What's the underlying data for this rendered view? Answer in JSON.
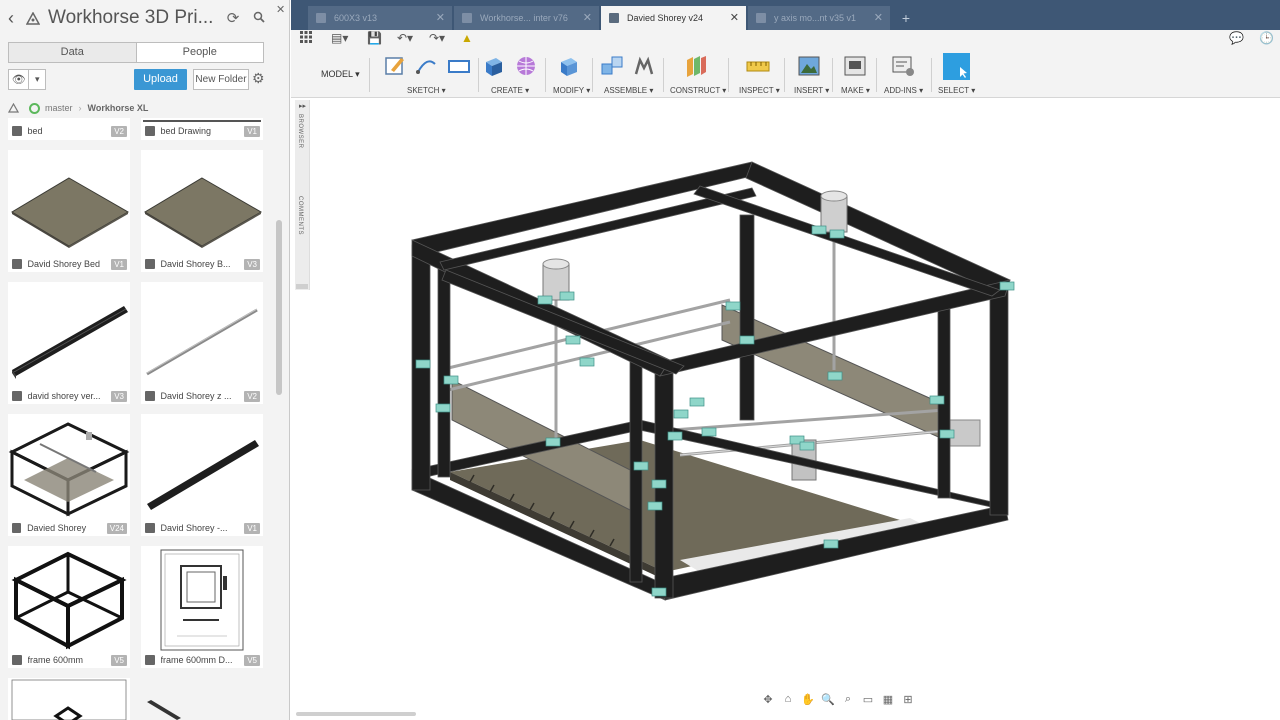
{
  "left_panel": {
    "title": "Workhorse 3D Pri...",
    "tabs": [
      "Data",
      "People"
    ],
    "upload_label": "Upload",
    "new_folder_label": "New Folder",
    "breadcrumb": [
      "master",
      "Workhorse XL"
    ],
    "files": [
      {
        "name": "bed",
        "version": "V2"
      },
      {
        "name": "bed Drawing",
        "version": "V1"
      },
      {
        "name": "David Shorey Bed",
        "version": "V1"
      },
      {
        "name": "David Shorey B...",
        "version": "V3"
      },
      {
        "name": "david shorey ver...",
        "version": "V3"
      },
      {
        "name": "David Shorey z ...",
        "version": "V2"
      },
      {
        "name": "Davied Shorey",
        "version": "V24"
      },
      {
        "name": "David Shorey -...",
        "version": "V1"
      },
      {
        "name": "frame 600mm",
        "version": "V5"
      },
      {
        "name": "frame 600mm D...",
        "version": "V5"
      }
    ]
  },
  "tabs": [
    {
      "label": "600X3 v13"
    },
    {
      "label": "Workhorse... inter v76"
    },
    {
      "label": "Davied Shorey v24"
    },
    {
      "label": "y axis mo...nt v35 v1"
    }
  ],
  "ribbon": {
    "workspace": "MODEL",
    "groups": [
      "SKETCH",
      "CREATE",
      "MODIFY",
      "ASSEMBLE",
      "CONSTRUCT",
      "INSPECT",
      "INSERT",
      "MAKE",
      "ADD-INS",
      "SELECT"
    ]
  },
  "side_strip": {
    "browser": "BROWSER",
    "comments": "COMMENTS"
  },
  "colors": {
    "tabbar": "#3e5775",
    "accent": "#3a97d4",
    "frame": "#1e1e1e",
    "plate": "#7c7764"
  }
}
